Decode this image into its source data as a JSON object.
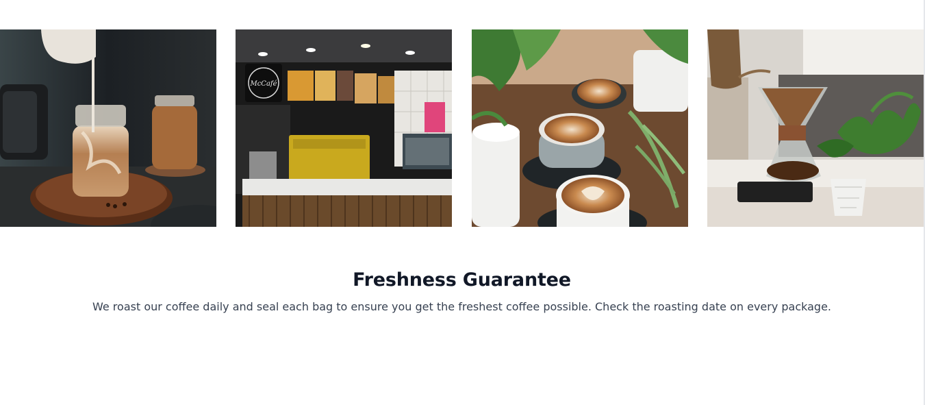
{
  "gallery": {
    "images": [
      {
        "alt": "iced-latte-jar-photo"
      },
      {
        "alt": "mccafe-counter-photo"
      },
      {
        "alt": "latte-art-cups-photo"
      },
      {
        "alt": "chemex-pour-over-photo"
      }
    ]
  },
  "info": {
    "title": "Freshness Guarantee",
    "description": "We roast our coffee daily and seal each bag to ensure you get the freshest coffee possible. Check the roasting date on every package."
  },
  "photo2": {
    "sign": "McCafé"
  },
  "colors": {
    "title": "#111827",
    "body": "#374151"
  }
}
